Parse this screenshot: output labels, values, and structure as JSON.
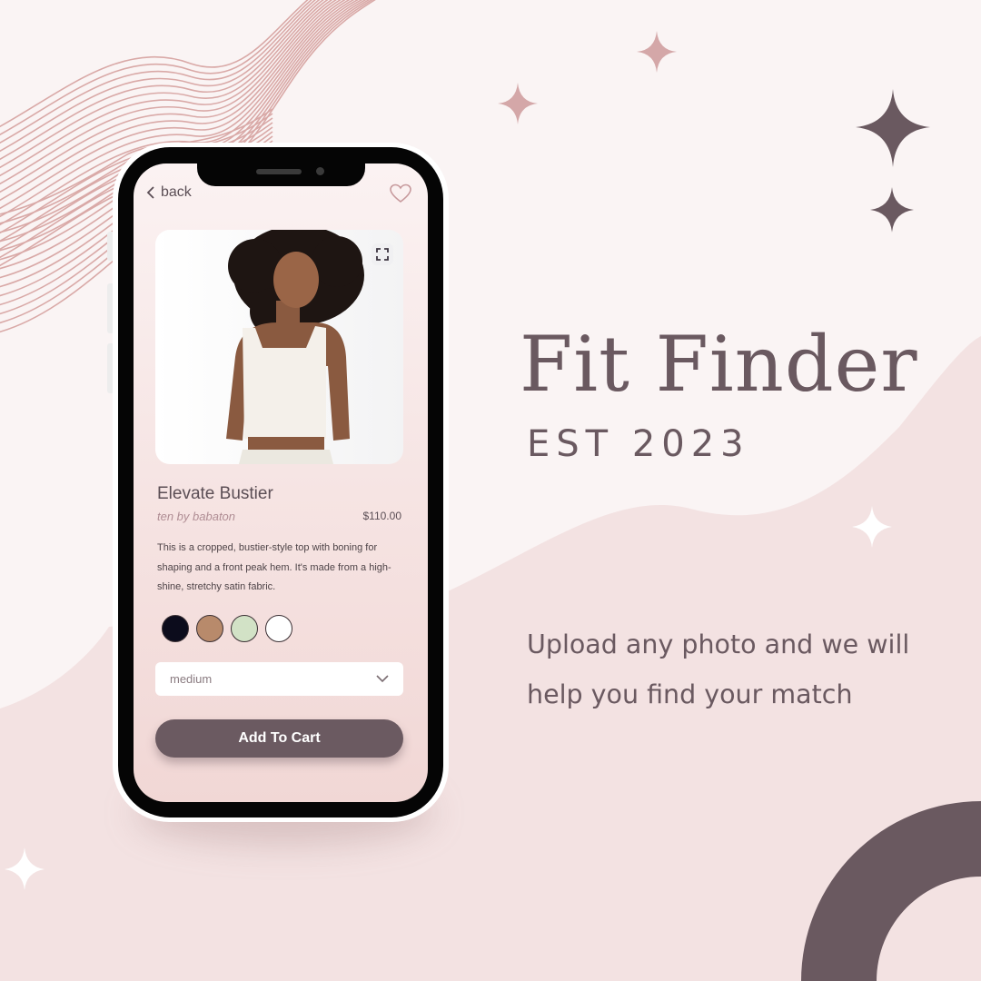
{
  "brand_header": {
    "title": "Fit Finder",
    "subtitle": "EST 2023",
    "tagline": "Upload any photo and we will help you find your match"
  },
  "app": {
    "nav": {
      "back_label": "back",
      "back_icon": "chevron-left-icon",
      "favorite_icon": "heart-icon"
    },
    "product": {
      "name": "Elevate Bustier",
      "brand": "ten by babaton",
      "price": "$110.00",
      "description": "This is a cropped, bustier-style top with boning for shaping and a front peak hem. It's made from a high-shine, stretchy satin fabric.",
      "image_icon": "expand-icon",
      "colors": [
        {
          "name": "black",
          "hex": "#0c0c1c"
        },
        {
          "name": "tan",
          "hex": "#b88a6b"
        },
        {
          "name": "sage",
          "hex": "#d2e2c6"
        },
        {
          "name": "white",
          "hex": "#ffffff"
        }
      ]
    },
    "size_select": {
      "value": "medium",
      "icon": "chevron-down-icon"
    },
    "cta": {
      "label": "Add To Cart"
    }
  },
  "palette": {
    "background": "#faf4f4",
    "blob": "#f3e2e2",
    "accent_dark": "#6a5960",
    "accent_rose": "#d4a7a8",
    "button": "#6b5a61"
  }
}
